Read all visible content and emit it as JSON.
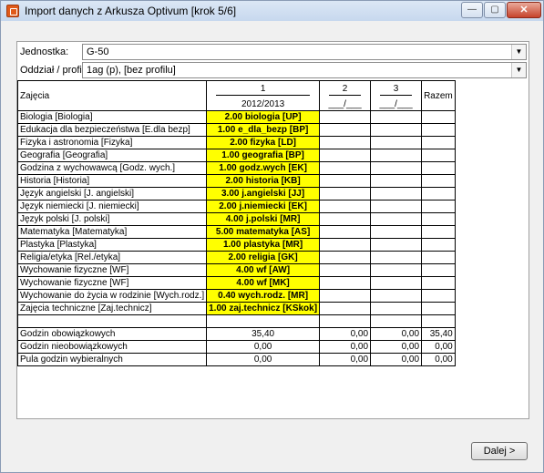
{
  "window": {
    "title": "Import danych z Arkusza Optivum [krok 5/6]",
    "buttons": {
      "minimize": "—",
      "maximize": "▢",
      "close": "✕"
    }
  },
  "form": {
    "jednostka_label": "Jednostka:",
    "jednostka_value": "G-50",
    "oddzial_label": "Oddział / profil:",
    "oddzial_value": "1ag (p), [bez profilu]"
  },
  "table": {
    "header": {
      "subject_col": "Zajęcia",
      "col1_num": "1",
      "col1_year": "2012/2013",
      "col2_num": "2",
      "col2_blank": "___/___",
      "col3_num": "3",
      "col3_blank": "___/___",
      "razem": "Razem"
    },
    "rows": [
      {
        "name": "Biologia [Biologia]",
        "value": "2.00 biologia [UP]"
      },
      {
        "name": "Edukacja dla bezpieczeństwa [E.dla bezp]",
        "value": "1.00 e_dla_bezp [BP]"
      },
      {
        "name": "Fizyka i astronomia [Fizyka]",
        "value": "2.00 fizyka [LD]"
      },
      {
        "name": "Geografia [Geografia]",
        "value": "1.00 geografia [BP]"
      },
      {
        "name": "Godzina z wychowawcą [Godz. wych.]",
        "value": "1.00 godz.wych [EK]"
      },
      {
        "name": "Historia [Historia]",
        "value": "2.00 historia [KB]"
      },
      {
        "name": "Język angielski [J. angielski]",
        "value": "3.00 j.angielski [JJ]"
      },
      {
        "name": "Język niemiecki [J. niemiecki]",
        "value": "2.00 j.niemiecki [EK]"
      },
      {
        "name": "Język polski [J. polski]",
        "value": "4.00 j.polski [MR]"
      },
      {
        "name": "Matematyka [Matematyka]",
        "value": "5.00 matematyka [AS]"
      },
      {
        "name": "Plastyka [Plastyka]",
        "value": "1.00 plastyka [MR]"
      },
      {
        "name": "Religia/etyka [Rel./etyka]",
        "value": "2.00 religia [GK]"
      },
      {
        "name": "Wychowanie fizyczne [WF]",
        "value": "4.00 wf [AW]"
      },
      {
        "name": "Wychowanie fizyczne [WF]",
        "value": "4.00 wf [MK]"
      },
      {
        "name": "Wychowanie do życia w rodzinie [Wych.rodz.]",
        "value": "0.40 wych.rodz. [MR]"
      },
      {
        "name": "Zajęcia techniczne [Zaj.technicz]",
        "value": "1.00 zaj.technicz [KSkok]"
      }
    ],
    "summary": [
      {
        "name": "Godzin obowiązkowych",
        "c1": "35,40",
        "c2": "0,00",
        "c3": "0,00",
        "razem": "35,40"
      },
      {
        "name": "Godzin nieobowiązkowych",
        "c1": "0,00",
        "c2": "0,00",
        "c3": "0,00",
        "razem": "0,00"
      },
      {
        "name": "Pula godzin wybieralnych",
        "c1": "0,00",
        "c2": "0,00",
        "c3": "0,00",
        "razem": "0,00"
      }
    ]
  },
  "footer": {
    "next_label": "Dalej >"
  }
}
